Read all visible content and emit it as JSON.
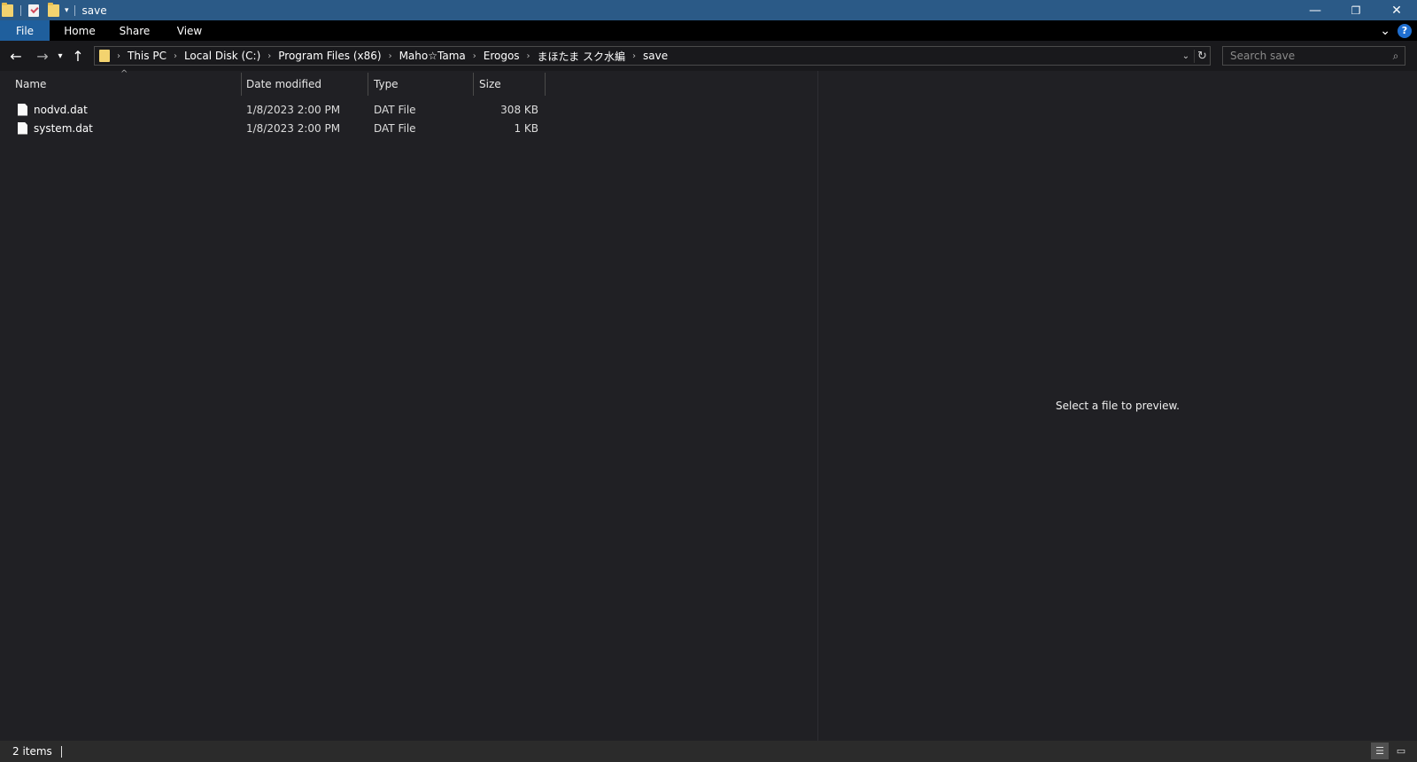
{
  "window": {
    "title": "save",
    "qa_dropdown": "▾",
    "minimize": "—",
    "restore": "❐",
    "close": "✕"
  },
  "ribbon": {
    "tabs": [
      "File",
      "Home",
      "Share",
      "View"
    ],
    "expand_icon": "⌄",
    "help": "?"
  },
  "navigation": {
    "back": "←",
    "forward": "→",
    "recent": "▾",
    "up": "↑"
  },
  "address": {
    "crumbs": [
      "This PC",
      "Local Disk (C:)",
      "Program Files (x86)",
      "Maho☆Tama",
      "Erogos",
      "まほたま スク水編",
      "save"
    ],
    "separator": "›",
    "dropdown": "⌄",
    "refresh": "↻"
  },
  "search": {
    "placeholder": "Search save",
    "icon": "⌕"
  },
  "columns": {
    "name": "Name",
    "date": "Date modified",
    "type": "Type",
    "size": "Size",
    "sort_indicator": "^"
  },
  "files": [
    {
      "name": "nodvd.dat",
      "date": "1/8/2023 2:00 PM",
      "type": "DAT File",
      "size": "308 KB"
    },
    {
      "name": "system.dat",
      "date": "1/8/2023 2:00 PM",
      "type": "DAT File",
      "size": "1 KB"
    }
  ],
  "preview": {
    "message": "Select a file to preview."
  },
  "status": {
    "item_count": "2 items",
    "details_view_icon": "☰",
    "large_icons_view_icon": "▭"
  },
  "colors": {
    "titlebar": "#2b5a87",
    "file_tab": "#1f5f9d",
    "background": "#202024",
    "folder": "#f3d36f"
  }
}
